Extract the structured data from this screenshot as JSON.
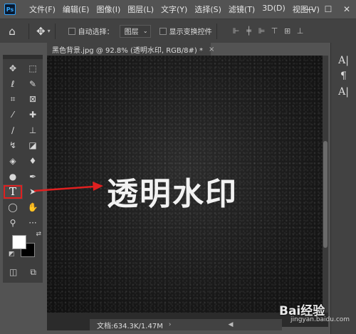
{
  "app": {
    "logo": "Ps"
  },
  "menu": [
    "文件(F)",
    "编辑(E)",
    "图像(I)",
    "图层(L)",
    "文字(Y)",
    "选择(S)",
    "滤镜(T)",
    "3D(D)",
    "视图(V)"
  ],
  "window_buttons": [
    "—",
    "☐",
    "✕"
  ],
  "options_bar": {
    "home_icon": "⌂",
    "move_icon": "✥",
    "auto_select_label": "自动选择：",
    "auto_select_value": "图层",
    "show_transform_label": "显示变换控件"
  },
  "document": {
    "tab_title": "黑色背景.jpg @ 92.8% (透明水印, RGB/8#) *",
    "tab_close": "×",
    "canvas_text": "透明水印",
    "status_text": "文档:634.3K/1.47M"
  },
  "tools": [
    {
      "name": "move-tool",
      "icon": "✥"
    },
    {
      "name": "marquee-tool",
      "icon": "⬚"
    },
    {
      "name": "lasso-tool",
      "icon": "ℓ"
    },
    {
      "name": "quick-select-tool",
      "icon": "✎"
    },
    {
      "name": "crop-tool",
      "icon": "⌗"
    },
    {
      "name": "frame-tool",
      "icon": "⊠"
    },
    {
      "name": "eyedropper-tool",
      "icon": "⁄"
    },
    {
      "name": "healing-brush-tool",
      "icon": "✚"
    },
    {
      "name": "brush-tool",
      "icon": "∕"
    },
    {
      "name": "stamp-tool",
      "icon": "⊥"
    },
    {
      "name": "history-brush-tool",
      "icon": "↯"
    },
    {
      "name": "eraser-tool",
      "icon": "◪"
    },
    {
      "name": "paint-bucket-tool",
      "icon": "◈"
    },
    {
      "name": "blur-tool",
      "icon": "♦"
    },
    {
      "name": "dodge-tool",
      "icon": "●"
    },
    {
      "name": "pen-tool",
      "icon": "✒"
    },
    {
      "name": "type-tool",
      "icon": "T",
      "selected": true
    },
    {
      "name": "path-select-tool",
      "icon": "➤"
    },
    {
      "name": "ellipse-tool",
      "icon": "◯"
    },
    {
      "name": "hand-tool",
      "icon": "✋"
    },
    {
      "name": "zoom-tool",
      "icon": "⚲"
    },
    {
      "name": "more-tools",
      "icon": "···"
    }
  ],
  "swatches": {
    "foreground": "#ffffff",
    "background": "#000000",
    "swap_icon": "⇄",
    "reset_icon": "◩"
  },
  "toolbox_bottom": [
    "◫",
    "⧉"
  ],
  "right_panel": [
    "A|",
    "¶",
    "A|"
  ],
  "watermark": {
    "brand": "Bai经验",
    "url": "jingyan.baidu.com"
  },
  "colors": {
    "annotation_red": "#e02020",
    "panel": "#424242",
    "app_bg": "#535353"
  }
}
